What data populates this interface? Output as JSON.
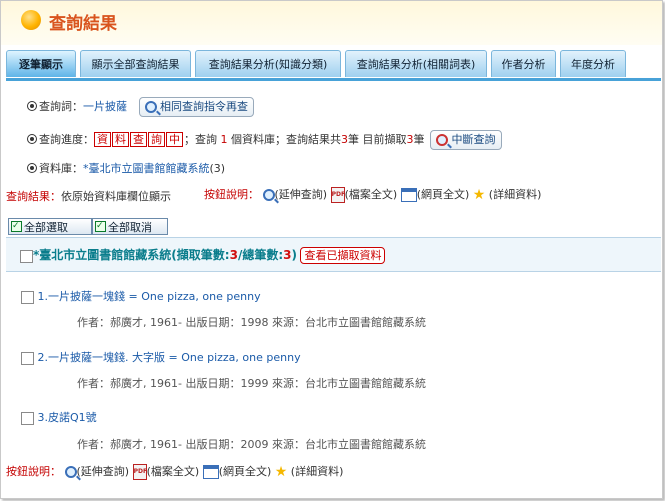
{
  "header": {
    "title": "查詢結果"
  },
  "tabs": [
    {
      "label": "逐筆顯示"
    },
    {
      "label": "顯示全部查詢結果"
    },
    {
      "label": "查詢結果分析(知識分類)"
    },
    {
      "label": "查詢結果分析(相關詞表)"
    },
    {
      "label": "作者分析"
    },
    {
      "label": "年度分析"
    }
  ],
  "query": {
    "label": "查詢詞：",
    "term": "一片披薩",
    "button": "相同查詢指令再查"
  },
  "progress": {
    "label": "查詢進度：",
    "chars": [
      "資",
      "料",
      "查",
      "詢",
      "中"
    ],
    "t1": "；查詢",
    "n1": "1",
    "t2": "個資料庫；查詢結果共",
    "n2": "3",
    "t3": "筆 目前擷取",
    "n3": "3",
    "t4": "筆",
    "stop_button": "中斷查詢"
  },
  "database": {
    "label": "資料庫：",
    "name": "*臺北市立圖書館館藏系統",
    "count": "(3)"
  },
  "result_line": {
    "label": "查詢結果：",
    "text": "依原始資料庫欄位顯示"
  },
  "legend": {
    "label": "按鈕說明：",
    "items": [
      {
        "icon": "magnifier-icon",
        "text": "(延伸查詢)"
      },
      {
        "icon": "pdf-icon",
        "text": "(檔案全文)"
      },
      {
        "icon": "webpage-icon",
        "text": "(網頁全文)"
      },
      {
        "icon": "star-icon",
        "text": "(詳細資料)"
      }
    ]
  },
  "select_all": "全部選取",
  "deselect_all": "全部取消",
  "group": {
    "name": "*臺北市立圖書館館藏系統",
    "retrieved_label": "(擷取筆數:",
    "retrieved": "3",
    "total_label": "/總筆數:",
    "total": "3",
    "close": ")",
    "button": "查看已擷取資料"
  },
  "records": [
    {
      "title": "1.一片披薩一塊錢 = One pizza, one penny",
      "meta": "作者：郝廣才, 1961-    出版日期：1998    來源：台北市立圖書館館藏系統"
    },
    {
      "title": "2.一片披薩一塊錢. 大字版 = One pizza, one penny",
      "meta": "作者：郝廣才, 1961-    出版日期：1999    來源：台北市立圖書館館藏系統"
    },
    {
      "title": "3.皮諾Q1號",
      "meta": "作者：郝廣才, 1961-    出版日期：2009    來源：台北市立圖書館館藏系統"
    }
  ],
  "colors": {
    "accent": "#d9541e",
    "tab": "#48a2d8",
    "link": "#1a5aa8",
    "alert": "#c40000"
  }
}
